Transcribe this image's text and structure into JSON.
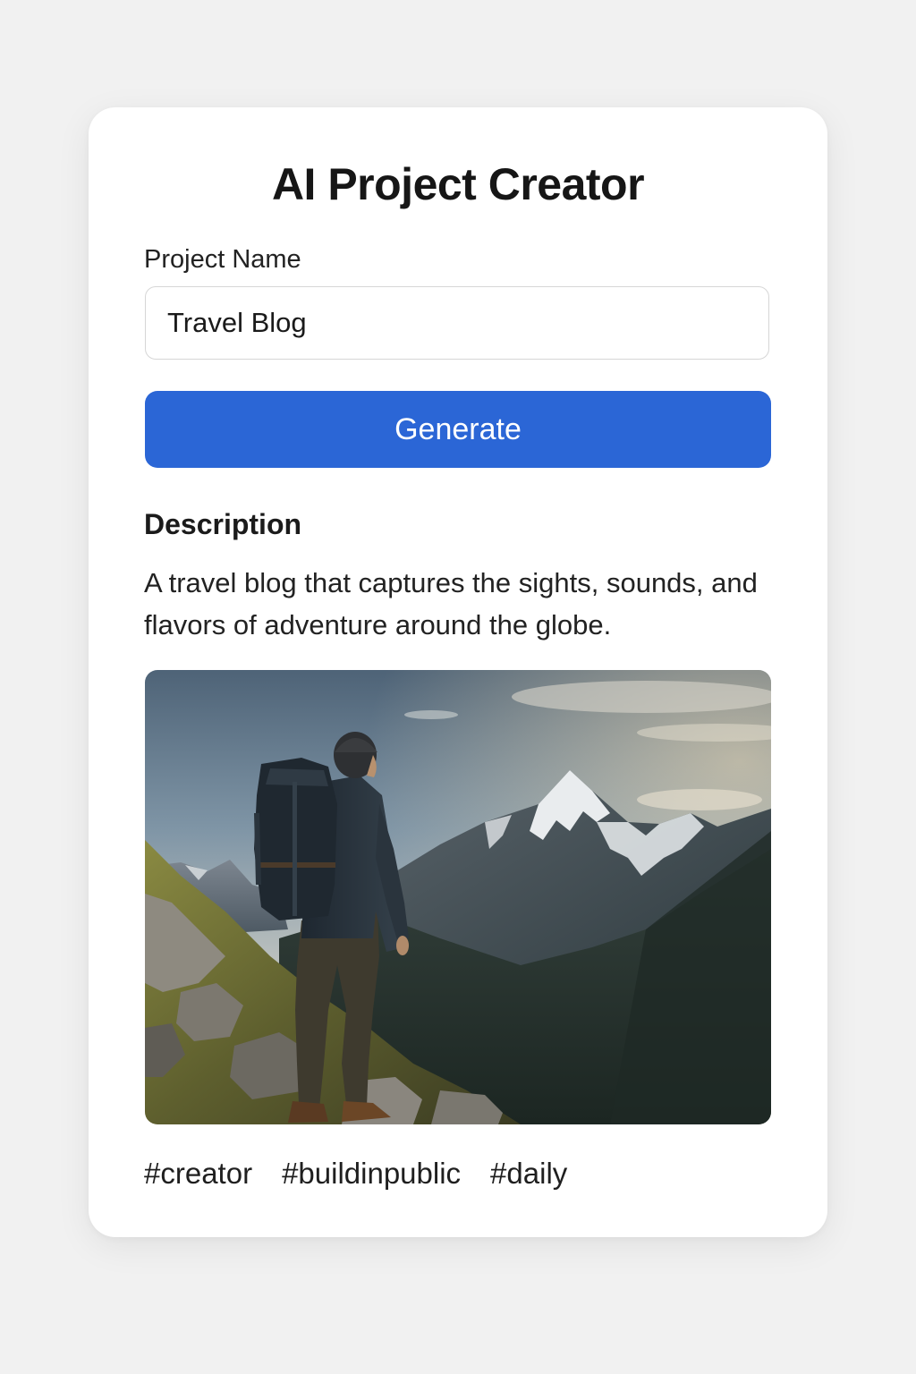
{
  "header": {
    "title": "AI Project Creator"
  },
  "form": {
    "project_name_label": "Project Name",
    "project_name_value": "Travel Blog",
    "generate_label": "Generate"
  },
  "result": {
    "description_heading": "Description",
    "description_text": "A travel blog that captures the sights, sounds, and flavors of adventure around the globe.",
    "image_subject": "hiker with backpack overlooking snowy mountain peak",
    "tags": [
      "#creator",
      "#buildinpublic",
      "#daily"
    ]
  },
  "colors": {
    "page_background": "#f1f1f1",
    "card_background": "#ffffff",
    "accent": "#2b66d6",
    "text": "#1b1b1b"
  }
}
